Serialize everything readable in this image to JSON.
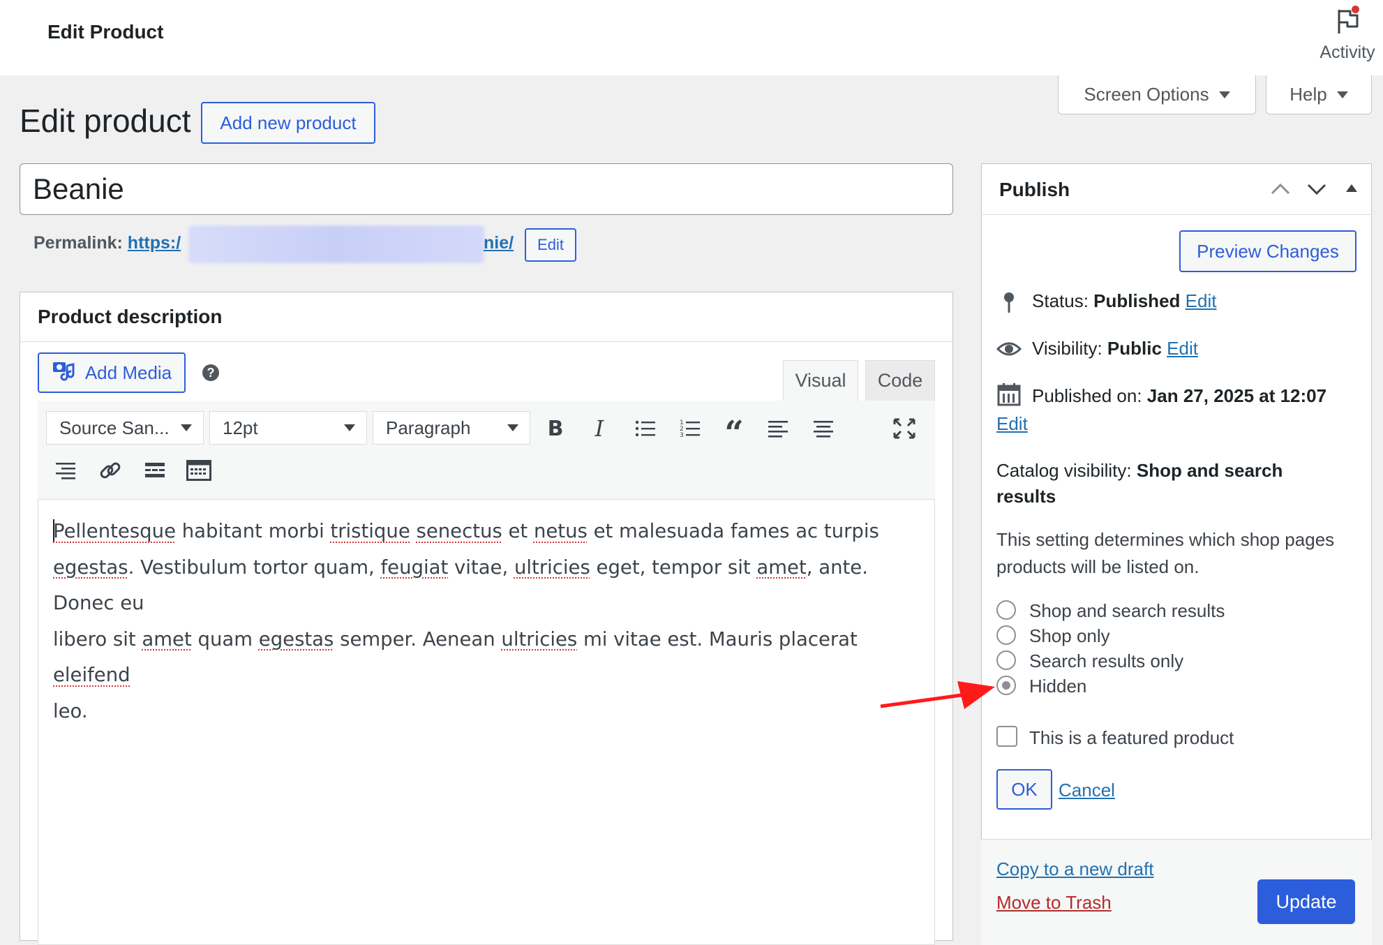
{
  "topbar": {
    "title": "Edit Product",
    "activity_label": "Activity"
  },
  "tabs": {
    "screen_options": "Screen Options",
    "help": "Help"
  },
  "page": {
    "title": "Edit product",
    "add_new": "Add new product"
  },
  "product": {
    "name": "Beanie",
    "permalink_label": "Permalink:",
    "permalink_start": "https:/",
    "permalink_end": "nie/",
    "permalink_edit": "Edit"
  },
  "description": {
    "title": "Product description",
    "add_media": "Add Media",
    "tab_visual": "Visual",
    "tab_code": "Code",
    "font_family": "Source San...",
    "font_size": "12pt",
    "format": "Paragraph",
    "content": {
      "w1": "Pellentesque",
      "t1": " habitant morbi ",
      "w2": "tristique",
      "t2": " ",
      "w3": "senectus",
      "t3": " et ",
      "w4": "netus",
      "t4": " et malesuada fames ac turpis",
      "w5": "egestas",
      "t5": ". Vestibulum tortor quam, ",
      "w6": "feugiat",
      "t6": " vitae, ",
      "w7": "ultricies",
      "t7": " eget, tempor sit ",
      "w8": "amet",
      "t8": ", ante. Donec eu",
      "t9": "libero sit ",
      "w9": "amet",
      "t10": " quam ",
      "w10": "egestas",
      "t11": " semper. Aenean ",
      "w11": "ultricies",
      "t12": " mi vitae est. Mauris placerat ",
      "w12": "eleifend",
      "t13": "leo."
    }
  },
  "publish": {
    "title": "Publish",
    "preview": "Preview Changes",
    "status_label": "Status:",
    "status_value": "Published",
    "visibility_label": "Visibility:",
    "visibility_value": "Public",
    "published_label": "Published on:",
    "published_value": "Jan 27, 2025 at 12:07",
    "edit": "Edit",
    "catalog_label": "Catalog visibility:",
    "catalog_value_1": "Shop and search",
    "catalog_value_2": "results",
    "catalog_desc_1": "This setting determines which shop pages",
    "catalog_desc_2": "products will be listed on.",
    "options": [
      "Shop and search results",
      "Shop only",
      "Search results only",
      "Hidden"
    ],
    "selected_option": "Hidden",
    "featured_label": "This is a featured product",
    "featured_checked": false,
    "ok": "OK",
    "cancel": "Cancel",
    "copy_draft": "Copy to a new draft",
    "trash": "Move to Trash",
    "update": "Update"
  },
  "colors": {
    "accent": "#2c5ddb",
    "trash": "#b32d2e",
    "annotation_arrow": "#ff1a1a"
  }
}
